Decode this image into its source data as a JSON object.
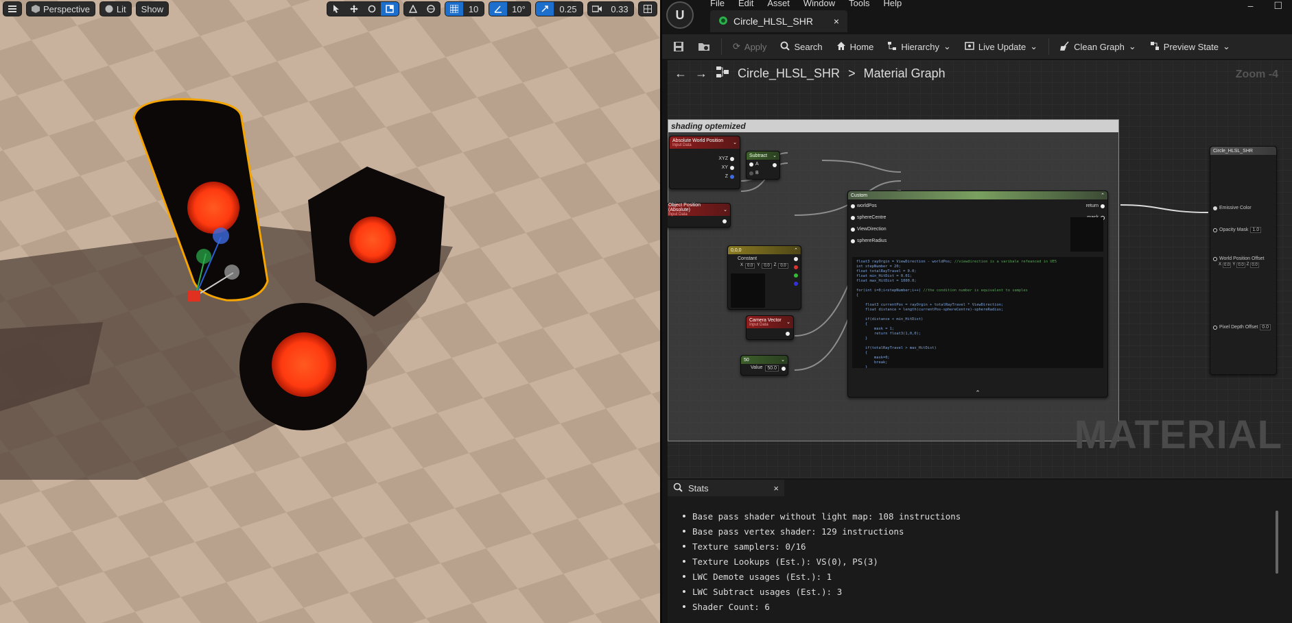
{
  "viewport": {
    "toolbar": {
      "menu_icon": "hamburger-icon",
      "view_mode": "Perspective",
      "lighting": "Lit",
      "show": "Show",
      "grid_snap": "10",
      "rotation_snap": "10°",
      "scale_snap": "0.25",
      "camera_speed": "0.33"
    }
  },
  "menu": [
    "File",
    "Edit",
    "Asset",
    "Window",
    "Tools",
    "Help"
  ],
  "document_tab": {
    "title": "Circle_HLSL_SHR",
    "close": "×"
  },
  "toolbar": {
    "apply": "Apply",
    "search": "Search",
    "home": "Home",
    "hierarchy": "Hierarchy",
    "live_update": "Live Update",
    "clean_graph": "Clean Graph",
    "preview_state": "Preview State"
  },
  "graph": {
    "breadcrumb_asset": "Circle_HLSL_SHR",
    "breadcrumb_sep": ">",
    "breadcrumb_graph": "Material Graph",
    "zoom": "Zoom -4",
    "watermark": "MATERIAL",
    "comment_title": "shading optemized",
    "nodes": {
      "abs_world_pos": {
        "title": "Absolute World Position",
        "sub": "Input Data",
        "pins": [
          "XYZ",
          "XY",
          "Z"
        ]
      },
      "obj_pos": {
        "title": "Object Position (Absolute)",
        "sub": "Input Data"
      },
      "subtract": {
        "title": "Subtract",
        "pins": [
          "A",
          "B"
        ]
      },
      "constant": {
        "title": "0,0,0",
        "label": "Constant",
        "x": "0.0",
        "y": "0.0",
        "z": "0.0"
      },
      "camera_vector": {
        "title": "Camera Vector",
        "sub": "Input Data"
      },
      "scalar": {
        "title": "50",
        "label": "Value",
        "value": "50.0"
      },
      "custom": {
        "title": "Custom",
        "inputs": [
          "worldPos",
          "sphereCentre",
          "ViewDirection",
          "sphereRadius"
        ],
        "outputs": [
          "return",
          "mask"
        ]
      },
      "result": {
        "title": "Circle_HLSL_SHR",
        "pins": [
          "Emissive Color",
          "Opacity Mask",
          "World Position Offset",
          "Pixel Depth Offset"
        ],
        "opacity_value": "1.0",
        "wpo_x": "0.0",
        "wpo_y": "0.0",
        "wpo_z": "0.0",
        "pdo_value": "0.0"
      }
    },
    "code_lines": [
      "float3 rayOrgin = ViewDirection - worldPos; //viewdirection is a varibale refeanced in UE5",
      "int stepNumber = 20;",
      "float totalRayTravel = 0.0;",
      "float min_HitDist = 0.01;",
      "float max_HitDist = 1000.0;",
      "",
      "for(int i=0;i<stepNumber;i++) //the condition number is equivalent to samples",
      "{",
      "",
      "    float3 currentPos = rayOrgin + totalRayTravel * ViewDirection;",
      "    float distance = length(currentPos-sphereCentre)-sphereRadius;",
      "",
      "    if(distance < min_HitDist)",
      "    {",
      "        mask = 1;",
      "        return float3(1,0,0);",
      "    }",
      "",
      "    if(totalRayTravel > max_HitDist)",
      "    {",
      "        mask=0;",
      "        break;",
      "    }",
      "    totalRayTravel += distance;",
      "}",
      "",
      "return float3(0,0,0);"
    ]
  },
  "stats": {
    "tab": "Stats",
    "close": "×",
    "items": [
      "Base pass shader without light map: 108 instructions",
      "Base pass vertex shader: 129 instructions",
      "Texture samplers: 0/16",
      "Texture Lookups (Est.): VS(0), PS(3)",
      "LWC Demote usages (Est.): 1",
      "LWC Subtract usages (Est.): 3",
      "Shader Count: 6"
    ]
  },
  "colors": {
    "accent": "#1d6fce",
    "sphere_emissive": "#ff3a10",
    "selection": "#f5a400"
  }
}
